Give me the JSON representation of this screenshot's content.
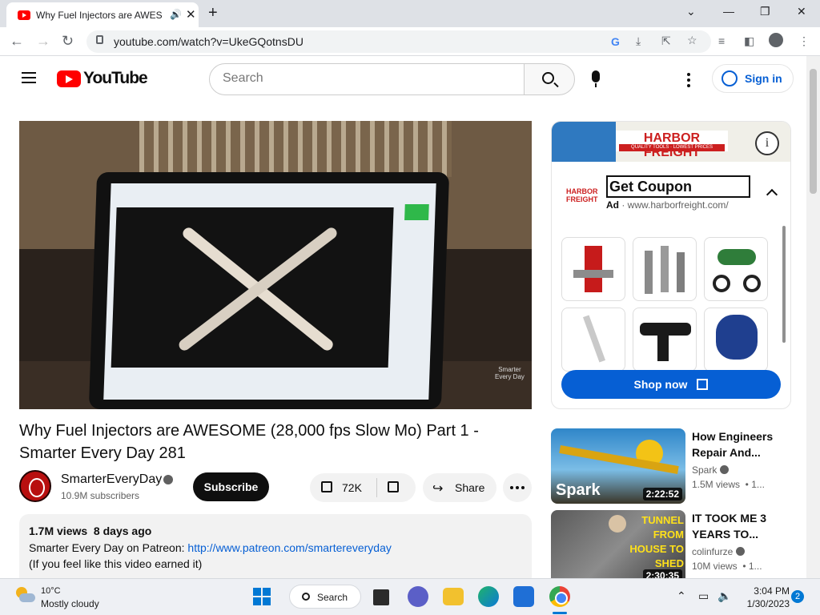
{
  "browser": {
    "tab_title": "Why Fuel Injectors are AWES",
    "tab_close": "✕",
    "new_tab": "+",
    "url": "youtube.com/watch?v=UkeGQotnsDU"
  },
  "header": {
    "logo_text": "YouTube",
    "search_placeholder": "Search",
    "signin_label": "Sign in"
  },
  "video": {
    "watermark": "Smarter\nEvery Day",
    "title": "Why Fuel Injectors are AWESOME (28,000 fps Slow Mo) Part 1 - Smarter Every Day 281",
    "channel": "SmarterEveryDay",
    "subscribers": "10.9M subscribers",
    "subscribe_label": "Subscribe",
    "likes": "72K",
    "share_label": "Share"
  },
  "description": {
    "meta": "1.7M views  8 days ago",
    "line1_prefix": "Smarter Every Day on Patreon: ",
    "line1_link": "http://www.patreon.com/smartereveryday",
    "line2": "(If you feel like this video earned it)"
  },
  "ad": {
    "brand": "HARBOR FREIGHT",
    "brand_tagline": "QUALITY TOOLS · LOWEST PRICES",
    "logo_line1": "HARBOR",
    "logo_line2": "FREIGHT",
    "headline": "Get Coupon",
    "ad_label": "Ad",
    "ad_url": " · www.harborfreight.com/",
    "cta": "Shop now"
  },
  "recommendations": [
    {
      "title": "How Engineers Repair And...",
      "channel": "Spark",
      "views": "1.5M views  • 1...",
      "duration": "2:22:52",
      "thumb_text": "Spark"
    },
    {
      "title": "IT TOOK ME 3 YEARS TO...",
      "channel": "colinfurze",
      "views": "10M views  • 1...",
      "duration": "2:30:35",
      "thumb_text": "TUNNEL FROM HOUSE TO SHED"
    }
  ],
  "taskbar": {
    "temperature": "10°C",
    "condition": "Mostly cloudy",
    "search_label": "Search",
    "time": "3:04 PM",
    "date": "1/30/2023",
    "notifications": "2"
  },
  "colors": {
    "accent_blue": "#065fd4",
    "youtube_red": "#ff0000",
    "harbor_red": "#cc1f1f"
  }
}
